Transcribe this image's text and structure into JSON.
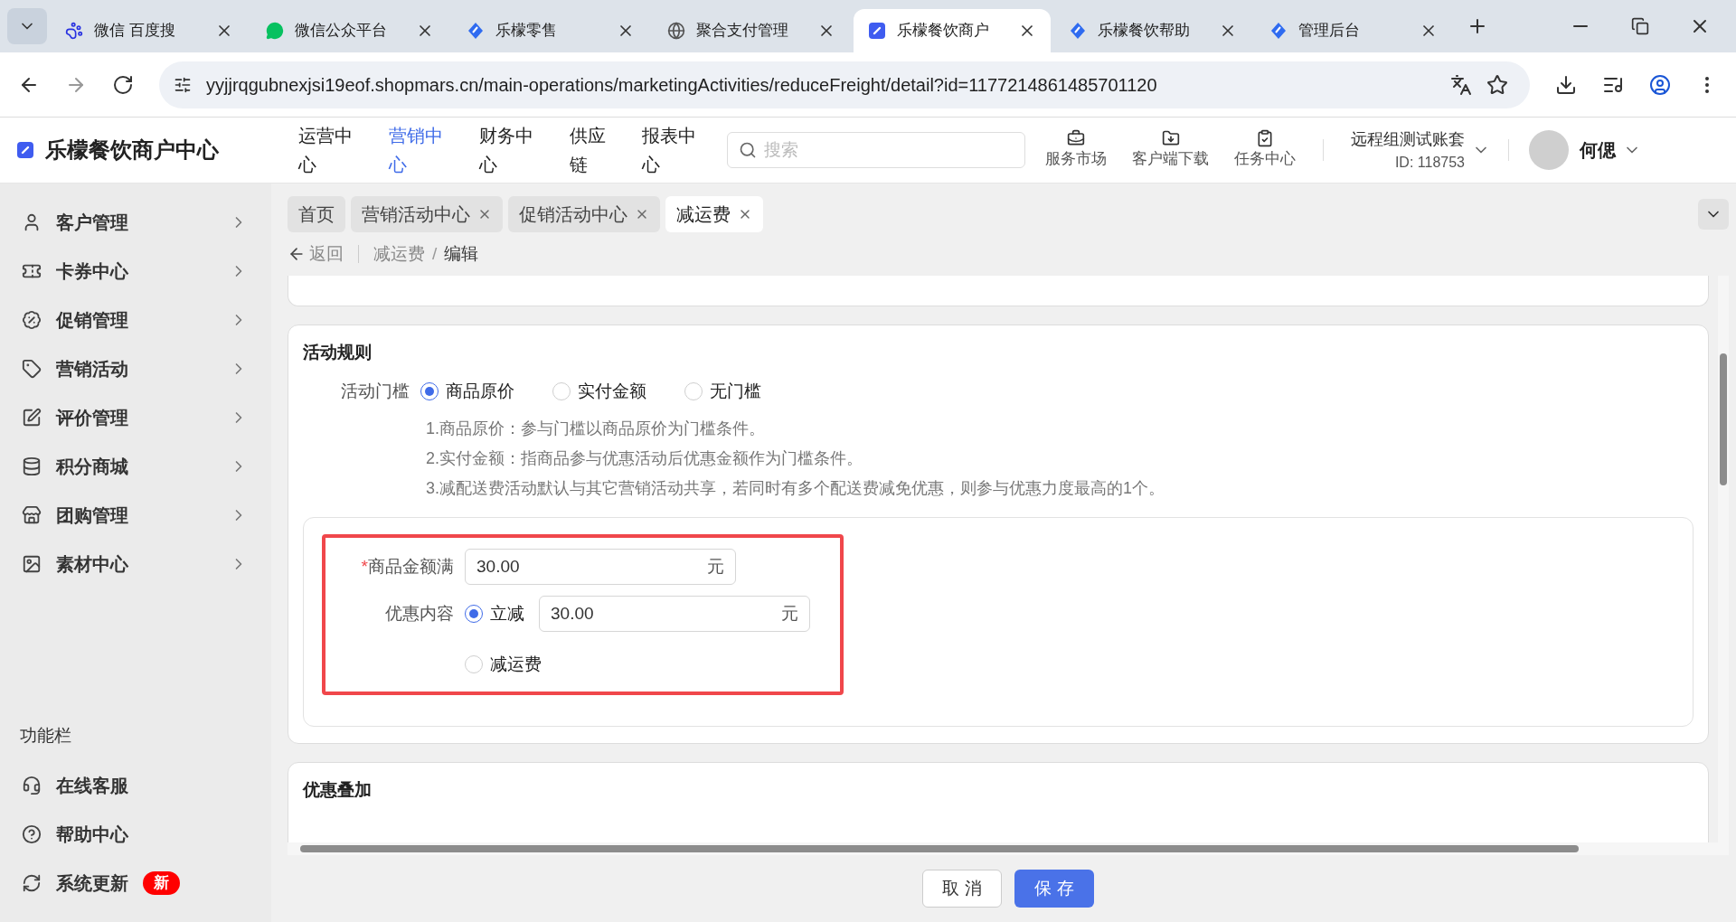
{
  "browser": {
    "tabs": [
      {
        "title": "微信 百度搜",
        "kind": "paw",
        "selected": false
      },
      {
        "title": "微信公众平台",
        "kind": "chat",
        "selected": false
      },
      {
        "title": "乐檬零售",
        "kind": "diamond",
        "selected": false
      },
      {
        "title": "聚合支付管理",
        "kind": "globe",
        "selected": false
      },
      {
        "title": "乐檬餐饮商户",
        "kind": "square",
        "selected": true
      },
      {
        "title": "乐檬餐饮帮助",
        "kind": "diamond",
        "selected": false
      },
      {
        "title": "管理后台",
        "kind": "diamond",
        "selected": false
      }
    ],
    "url": "yyjjrqgubnexjsi19eof.shopmars.cn/main-operations/marketingActivities/reduceFreight/detail?id=1177214861485701120"
  },
  "header": {
    "brand": "乐檬餐饮商户中心",
    "nav": [
      {
        "label": "运营中心",
        "selected": false
      },
      {
        "label": "营销中心",
        "selected": true
      },
      {
        "label": "财务中心",
        "selected": false
      },
      {
        "label": "供应链",
        "selected": false
      },
      {
        "label": "报表中心",
        "selected": false
      }
    ],
    "search": {
      "placeholder": "搜索"
    },
    "tools": [
      {
        "label": "服务市场"
      },
      {
        "label": "客户端下载"
      },
      {
        "label": "任务中心"
      }
    ],
    "account": {
      "name": "远程组测试账套",
      "id": "ID: 118753"
    },
    "user": "何偲"
  },
  "sidebar": {
    "items": [
      {
        "label": "客户管理"
      },
      {
        "label": "卡券中心"
      },
      {
        "label": "促销管理"
      },
      {
        "label": "营销活动"
      },
      {
        "label": "评价管理"
      },
      {
        "label": "积分商城"
      },
      {
        "label": "团购管理"
      },
      {
        "label": "素材中心"
      }
    ],
    "section_title": "功能栏",
    "extras": [
      {
        "label": "在线客服"
      },
      {
        "label": "帮助中心"
      },
      {
        "label": "系统更新",
        "badge": "新"
      }
    ]
  },
  "page_tabs": [
    {
      "label": "首页",
      "selected": false,
      "closable": false
    },
    {
      "label": "营销活动中心",
      "selected": false,
      "closable": true
    },
    {
      "label": "促销活动中心",
      "selected": false,
      "closable": true
    },
    {
      "label": "减运费",
      "selected": true,
      "closable": true
    }
  ],
  "breadcrumb": {
    "back": "返回",
    "separator": "/",
    "path": [
      "减运费",
      "编辑"
    ]
  },
  "rules": {
    "title": "活动规则",
    "threshold": {
      "label": "活动门槛",
      "options": [
        {
          "label": "商品原价",
          "selected": true
        },
        {
          "label": "实付金额",
          "selected": false
        },
        {
          "label": "无门槛",
          "selected": false
        }
      ]
    },
    "notes": [
      "1.商品原价：参与门槛以商品原价为门槛条件。",
      "2.实付金额：指商品参与优惠活动后优惠金额作为门槛条件。",
      "3.减配送费活动默认与其它营销活动共享，若同时有多个配送费减免优惠，则参与优惠力度最高的1个。"
    ],
    "amount": {
      "label": "商品金额满",
      "required_mark": "*",
      "value": "30.00",
      "unit": "元"
    },
    "discount": {
      "label": "优惠内容",
      "options": [
        {
          "kind": "input",
          "label": "立减",
          "selected": true,
          "value": "30.00",
          "unit": "元"
        },
        {
          "kind": "plain",
          "label": "减运费",
          "selected": false
        }
      ]
    }
  },
  "stacking": {
    "title": "优惠叠加"
  },
  "footer": {
    "cancel": "取 消",
    "save": "保 存"
  }
}
